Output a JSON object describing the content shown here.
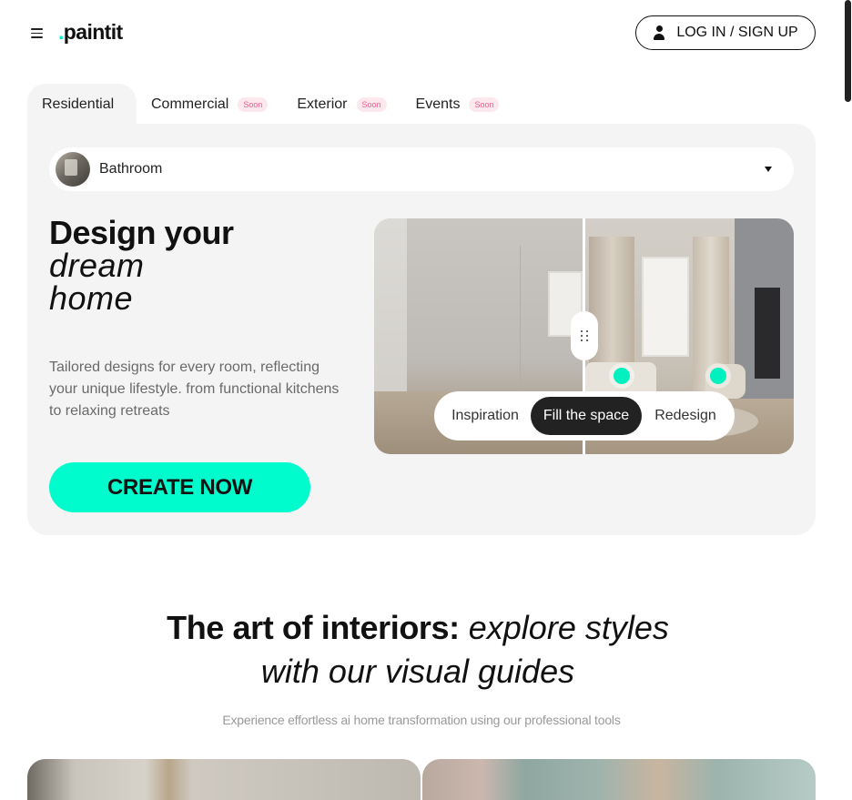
{
  "header": {
    "logo_dot": ".",
    "logo_text": "paintit",
    "login_label": "LOG IN / SIGN UP"
  },
  "tabs": [
    {
      "label": "Residential",
      "badge": ""
    },
    {
      "label": "Commercial",
      "badge": "Soon"
    },
    {
      "label": "Exterior",
      "badge": "Soon"
    },
    {
      "label": "Events",
      "badge": "Soon"
    }
  ],
  "hero": {
    "room_select": "Bathroom",
    "title_line1": "Design your",
    "title_line2": "dream",
    "title_line3": "home",
    "description": "Tailored designs for every room, reflecting your unique lifestyle. from functional kitchens to relaxing retreats",
    "cta": "CREATE NOW",
    "modes": [
      "Inspiration",
      "Fill the space",
      "Redesign"
    ],
    "active_mode": "Fill the space"
  },
  "section": {
    "title_bold": "The art of interiors:",
    "title_italic_1": "explore styles",
    "title_italic_2": "with our visual guides",
    "subtitle": "Experience effortless ai home transformation using our professional tools"
  },
  "colors": {
    "accent": "#00fccc",
    "badge_text": "#e8618c",
    "badge_bg": "#fde8ee",
    "card_bg": "#f4f4f4"
  },
  "icons": [
    "menu-icon",
    "user-icon",
    "chevron-down-icon",
    "drag-handle-icon"
  ]
}
